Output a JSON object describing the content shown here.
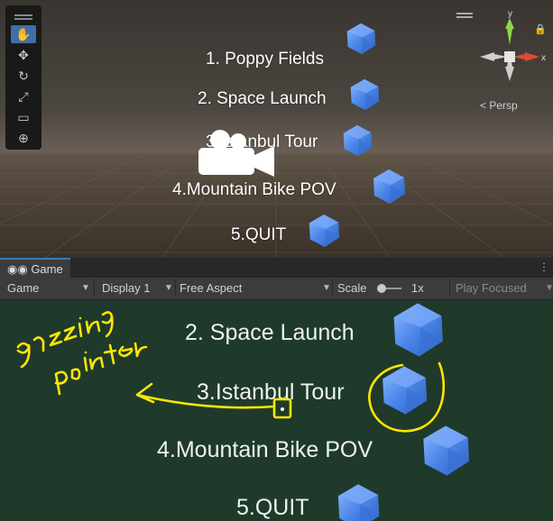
{
  "scene": {
    "menu_items": [
      "1. Poppy Fields",
      "2. Space Launch",
      "3.Istanbul Tour",
      "4.Mountain Bike POV",
      "5.QUIT"
    ],
    "gizmo": {
      "y_label": "y",
      "x_label": "x",
      "persp_label": "< Persp"
    },
    "tools": [
      "hand-tool",
      "move-tool",
      "rotate-tool",
      "scale-tool",
      "rect-tool",
      "transform-tool"
    ]
  },
  "game_tab": {
    "label": "Game",
    "icon": "gamepad-icon"
  },
  "game_toolbar": {
    "mode": "Game",
    "display": "Display 1",
    "aspect": "Free Aspect",
    "scale_label": "Scale",
    "scale_value": "1x",
    "play_focused": "Play Focused"
  },
  "game_view": {
    "menu_items": [
      "2. Space Launch",
      "3.Istanbul Tour",
      "4.Mountain Bike POV",
      "5.QUIT"
    ]
  },
  "annotation": {
    "text": "gazzing pointer",
    "color": "#ffe600"
  },
  "colors": {
    "gem": "#4a86e8",
    "highlight": "#3a79bb",
    "game_bg": "#1f3a2b"
  }
}
